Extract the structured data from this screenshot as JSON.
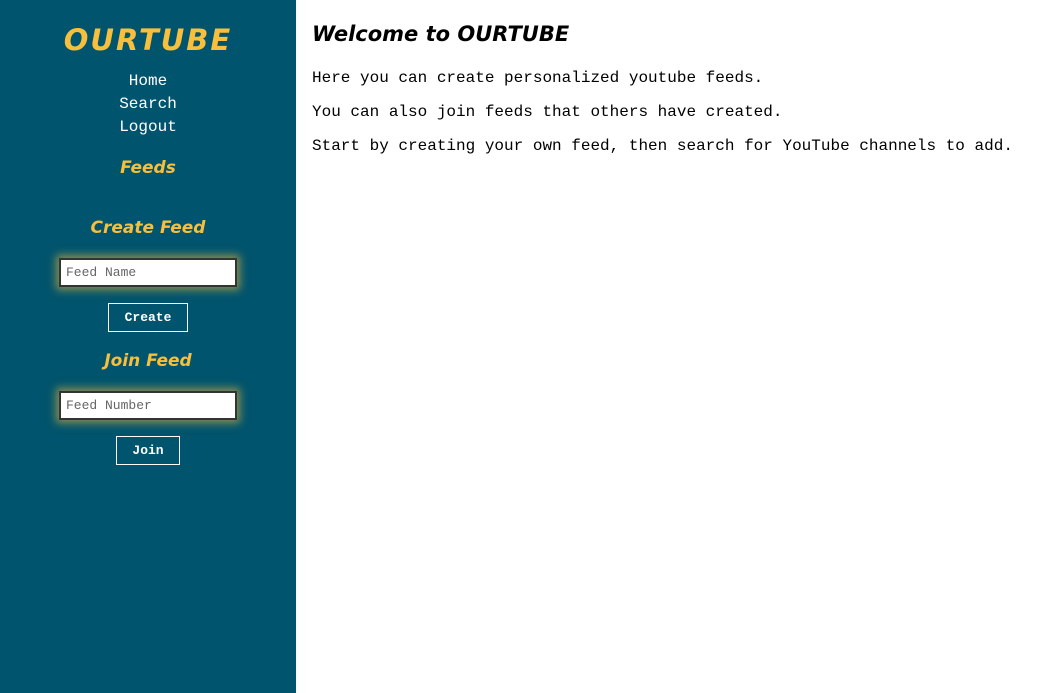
{
  "sidebar": {
    "brand": "OURTUBE",
    "nav": [
      {
        "label": "Home"
      },
      {
        "label": "Search"
      },
      {
        "label": "Logout"
      }
    ],
    "feeds_heading": "Feeds",
    "create_feed": {
      "heading": "Create Feed",
      "placeholder": "Feed Name",
      "button_label": "Create"
    },
    "join_feed": {
      "heading": "Join Feed",
      "placeholder": "Feed Number",
      "button_label": "Join"
    }
  },
  "main": {
    "title": "Welcome to OURTUBE",
    "paragraphs": [
      "Here you can create personalized youtube feeds.",
      "You can also join feeds that others have created.",
      "Start by creating your own feed, then search for YouTube channels to add."
    ]
  },
  "colors": {
    "sidebar_bg": "#00546d",
    "accent": "#f7bf3b",
    "text_light": "#ffffff",
    "main_bg": "#ffffff"
  }
}
